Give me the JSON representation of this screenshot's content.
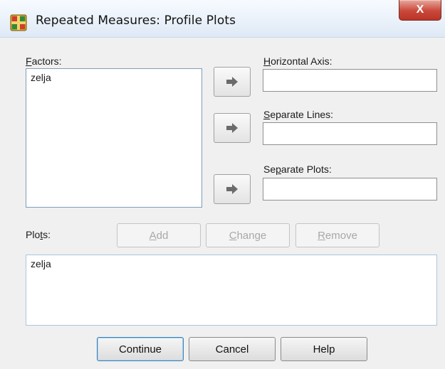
{
  "window": {
    "title": "Repeated Measures: Profile Plots",
    "close_label": "X"
  },
  "factors": {
    "label_prefix": "",
    "label_mnemonic": "F",
    "label_rest": "actors:",
    "items": [
      "zelja"
    ]
  },
  "horizontal_axis": {
    "label_mnemonic": "H",
    "label_rest": "orizontal Axis:",
    "value": ""
  },
  "separate_lines": {
    "label_mnemonic": "S",
    "label_rest": "eparate Lines:",
    "value": ""
  },
  "separate_plots": {
    "label_prefix": "Se",
    "label_mnemonic": "p",
    "label_rest": "arate Plots:",
    "value": ""
  },
  "plots": {
    "label_prefix": "Plo",
    "label_mnemonic": "t",
    "label_rest": "s:",
    "items": [
      "zelja"
    ]
  },
  "plot_buttons": {
    "add_mnemonic": "A",
    "add_rest": "dd",
    "change_mnemonic": "C",
    "change_rest": "hange",
    "remove_mnemonic": "R",
    "remove_rest": "emove"
  },
  "footer": {
    "continue_label": "Continue",
    "cancel_label": "Cancel",
    "help_label": "Help"
  },
  "icons": {
    "app": "spss-icon",
    "move": "move-arrow-icon"
  }
}
